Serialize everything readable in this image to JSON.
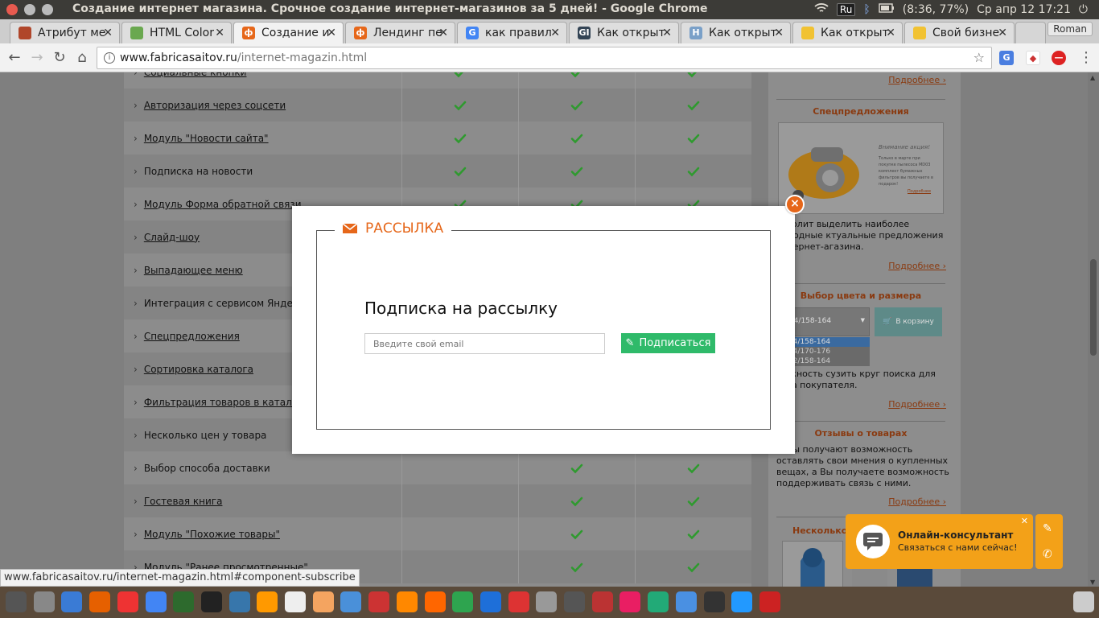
{
  "os": {
    "title": "Создание интернет магазина. Срочное создание интернет-магазинов за 5 дней! - Google Chrome",
    "keyboard": "Ru",
    "battery": "(8:36, 77%)",
    "datetime": "Ср апр 12 17:21"
  },
  "tabs": [
    {
      "label": "Атрибут ме",
      "color": "#b0462a",
      "glyph": ""
    },
    {
      "label": "HTML Color",
      "color": "#6aa84f",
      "glyph": ""
    },
    {
      "label": "Создание и",
      "color": "#e6671a",
      "glyph": "ф"
    },
    {
      "label": "Лендинг пе",
      "color": "#e6671a",
      "glyph": "ф"
    },
    {
      "label": "как правил",
      "color": "#4285f4",
      "glyph": "G"
    },
    {
      "label": "Как открыт",
      "color": "#345",
      "glyph": "GI"
    },
    {
      "label": "Как открыт",
      "color": "#7aa0c8",
      "glyph": "H"
    },
    {
      "label": "Как открыт",
      "color": "#f1c232",
      "glyph": ""
    },
    {
      "label": "Свой бизне",
      "color": "#f1c232",
      "glyph": ""
    }
  ],
  "profile": "Roman",
  "url": {
    "host": "www.fabricasaitov.ru",
    "path": "/internet-magazin.html"
  },
  "features": [
    {
      "name": "Социальные кнопки",
      "link": true,
      "c1": true,
      "c2": true,
      "c3": true
    },
    {
      "name": "Авторизация через соцсети",
      "link": true,
      "c1": true,
      "c2": true,
      "c3": true
    },
    {
      "name": "Модуль \"Новости сайта\"",
      "link": true,
      "c1": true,
      "c2": true,
      "c3": true
    },
    {
      "name": "Подписка на новости",
      "link": false,
      "c1": true,
      "c2": true,
      "c3": true
    },
    {
      "name": "Модуль Форма обратной связи",
      "link": true,
      "c1": true,
      "c2": true,
      "c3": true
    },
    {
      "name": "Слайд-шоу",
      "link": true,
      "c1": false,
      "c2": false,
      "c3": false
    },
    {
      "name": "Выпадающее меню",
      "link": true,
      "c1": false,
      "c2": false,
      "c3": false
    },
    {
      "name": "Интеграция с сервисом Яндекс.М",
      "link": false,
      "c1": false,
      "c2": false,
      "c3": false
    },
    {
      "name": "Спецпредложения",
      "link": true,
      "c1": false,
      "c2": false,
      "c3": false
    },
    {
      "name": "Сортировка каталога",
      "link": true,
      "c1": false,
      "c2": false,
      "c3": false
    },
    {
      "name": "Фильтрация товаров в каталоге",
      "link": true,
      "c1": false,
      "c2": false,
      "c3": false
    },
    {
      "name": "Несколько цен у товара",
      "link": false,
      "c1": false,
      "c2": false,
      "c3": false
    },
    {
      "name": "Выбор способа доставки",
      "link": false,
      "c1": false,
      "c2": true,
      "c3": true
    },
    {
      "name": "Гостевая книга",
      "link": true,
      "c1": false,
      "c2": true,
      "c3": true
    },
    {
      "name": "Модуль \"Похожие товары\"",
      "link": true,
      "c1": false,
      "c2": true,
      "c3": true
    },
    {
      "name": "Модуль \"Ранее просмотренные\"",
      "link": true,
      "c1": false,
      "c2": true,
      "c3": true
    }
  ],
  "sidebar": {
    "more": "Подробнее ›",
    "special_title": "Спецпредложения",
    "special_promo_title": "Внимание акция!",
    "special_promo_text": "Только в марте при покупке пылесоса MD03 комплект бумажных фильтров вы получаете в подарок!",
    "special_promo_link": "Подробнее",
    "special_text": "озволит выделить наиболее выгодные ктуальные предложения интернет-агазина.",
    "color_title": "Выбор цвета и размера",
    "color_select": "0-84/158-164",
    "color_options": [
      "0-84/158-164",
      "0-84/170-176",
      "8-92/158-164"
    ],
    "cart_label": "В корзину",
    "color_text": "можность сузить круг поиска для ства покупателя.",
    "reviews_title": "Отзывы о товарах",
    "reviews_text": "енты получают возможность оставлять свои мнения о купленных вещах, а Вы получаете возможность поддерживать связь с ними.",
    "bottom_title": "Несколько ц"
  },
  "modal": {
    "legend": "РАССЫЛКА",
    "heading": "Подписка на рассылку",
    "email_placeholder": "Введите свой email",
    "subscribe_label": "Подписаться"
  },
  "consultant": {
    "title": "Онлайн-консультант",
    "subtitle": "Связаться с нами сейчас!"
  },
  "statusbar": "www.fabricasaitov.ru/internet-magazin.html#component-subscribe",
  "colors": {
    "accent": "#e6671a",
    "green": "#2fba6a",
    "check": "#2f9a2f"
  }
}
